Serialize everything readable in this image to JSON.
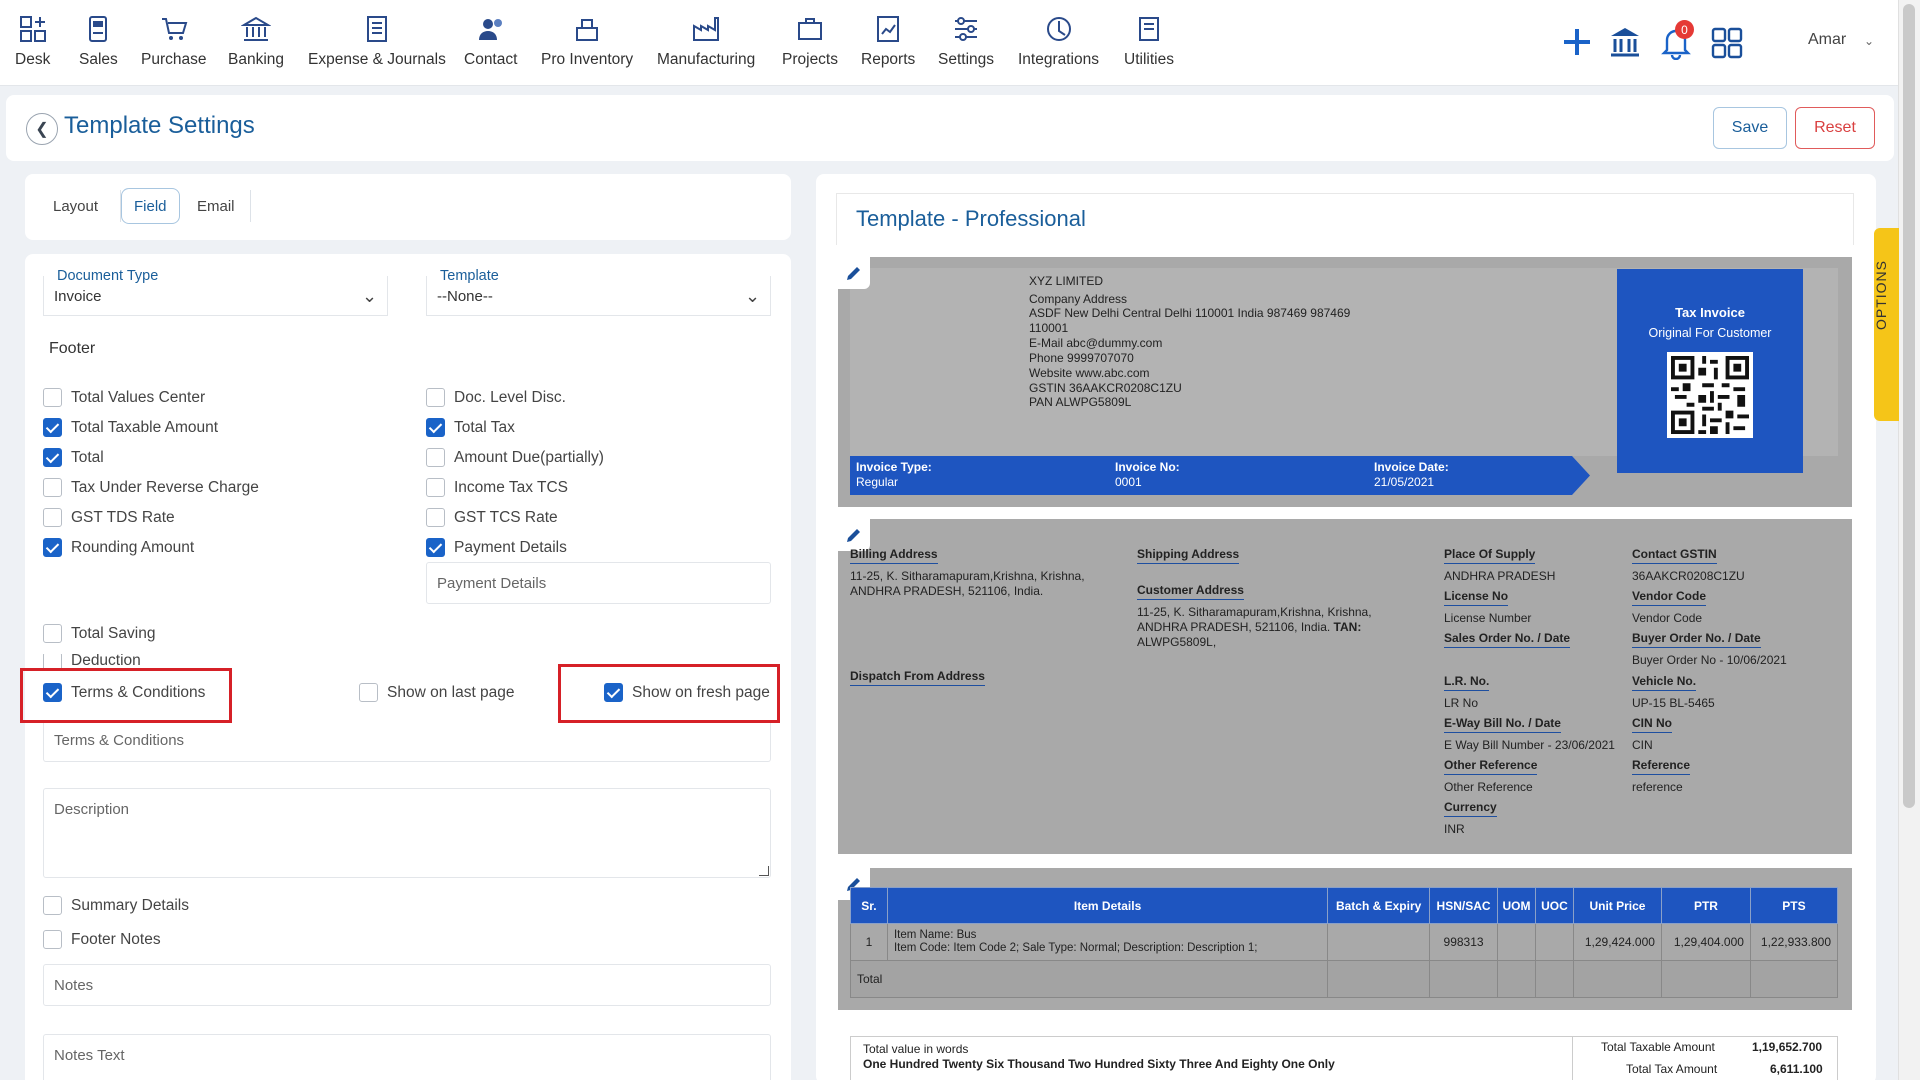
{
  "nav": {
    "items": [
      {
        "label": "Desk",
        "icon": "desk-icon"
      },
      {
        "label": "Sales",
        "icon": "sales-icon"
      },
      {
        "label": "Purchase",
        "icon": "purchase-cart-icon"
      },
      {
        "label": "Banking",
        "icon": "bank-icon"
      },
      {
        "label": "Expense & Journals",
        "icon": "journal-icon"
      },
      {
        "label": "Contact",
        "icon": "contact-icon"
      },
      {
        "label": "Pro Inventory",
        "icon": "inventory-icon"
      },
      {
        "label": "Manufacturing",
        "icon": "factory-icon"
      },
      {
        "label": "Projects",
        "icon": "projects-icon"
      },
      {
        "label": "Reports",
        "icon": "reports-icon"
      },
      {
        "label": "Settings",
        "icon": "sliders-icon"
      },
      {
        "label": "Integrations",
        "icon": "integrations-icon"
      },
      {
        "label": "Utilities",
        "icon": "utilities-icon"
      }
    ],
    "notification_count": "0",
    "user": "Amar",
    "accent": "#1a63c8"
  },
  "page": {
    "title": "Template Settings",
    "save": "Save",
    "reset": "Reset"
  },
  "tabs": {
    "layout": "Layout",
    "field": "Field",
    "email": "Email"
  },
  "form": {
    "doc_type_label": "Document Type",
    "doc_type_value": "Invoice",
    "template_label": "Template",
    "template_value": "--None--",
    "footer_heading": "Footer",
    "left_checks": [
      {
        "label": "Total Values Center",
        "checked": false
      },
      {
        "label": "Total Taxable Amount",
        "checked": true
      },
      {
        "label": "Total",
        "checked": true
      },
      {
        "label": "Tax Under Reverse Charge",
        "checked": false
      },
      {
        "label": "GST TDS Rate",
        "checked": false
      },
      {
        "label": "Rounding Amount",
        "checked": true
      }
    ],
    "right_checks": [
      {
        "label": "Doc. Level Disc.",
        "checked": false
      },
      {
        "label": "Total Tax",
        "checked": true
      },
      {
        "label": "Amount Due(partially)",
        "checked": false
      },
      {
        "label": "Income Tax TCS",
        "checked": false
      },
      {
        "label": "GST TCS Rate",
        "checked": false
      },
      {
        "label": "Payment Details",
        "checked": true
      }
    ],
    "payment_details_field": "Payment Details",
    "total_saving": "Total Saving",
    "deduction": "Deduction",
    "terms": "Terms & Conditions",
    "show_last_page": "Show on last page",
    "show_fresh_page": "Show on fresh page",
    "terms_field": "Terms & Conditions",
    "description_placeholder": "Description",
    "summary_details": "Summary Details",
    "footer_notes": "Footer Notes",
    "notes_field": "Notes",
    "notes_text_placeholder": "Notes Text"
  },
  "preview": {
    "title": "Template - Professional",
    "options": "OPTIONS",
    "company": {
      "name": "XYZ LIMITED",
      "address_label": "Company Address",
      "address_1": "ASDF New Delhi Central Delhi 110001 India 987469 987469",
      "address_2": "110001",
      "email_label": "E-Mail",
      "email": "abc@dummy.com",
      "phone_label": "Phone",
      "phone": "9999707070",
      "website_label": "Website",
      "website": "www.abc.com",
      "gstin_label": "GSTIN",
      "gstin": "36AAKCR0208C1ZU",
      "pan_label": "PAN",
      "pan": "ALWPG5809L"
    },
    "tax_box": {
      "title": "Tax Invoice",
      "subtitle": "Original For Customer"
    },
    "banner": {
      "type_label": "Invoice Type:",
      "type_value": "Regular",
      "no_label": "Invoice No:",
      "no_value": "0001",
      "date_label": "Invoice Date:",
      "date_value": "21/05/2021"
    },
    "billing_label": "Billing Address",
    "billing_1": "11-25, K. Sitharamapuram,Krishna, Krishna,",
    "billing_2": "ANDHRA PRADESH, 521106, India.",
    "shipping_label": "Shipping Address",
    "customer_label": "Customer Address",
    "customer_1": "11-25, K. Sitharamapuram,Krishna, Krishna,",
    "customer_2": "ANDHRA PRADESH, 521106, India.",
    "customer_tan_label": "TAN:",
    "customer_3": "ALWPG5809L,",
    "dispatch_label": "Dispatch From Address",
    "col3": [
      {
        "label": "Place Of Supply",
        "value": "ANDHRA PRADESH"
      },
      {
        "label": "License No",
        "value": "License Number"
      },
      {
        "label": "Sales Order No. / Date",
        "value": ""
      },
      {
        "label": "L.R. No.",
        "value": "LR No"
      },
      {
        "label": "E-Way Bill No. / Date",
        "value": "E Way Bill Number - 23/06/2021"
      },
      {
        "label": "Other Reference",
        "value": "Other Reference"
      },
      {
        "label": "Currency",
        "value": "INR"
      }
    ],
    "col4": [
      {
        "label": "Contact GSTIN",
        "value": "36AAKCR0208C1ZU"
      },
      {
        "label": "Vendor Code",
        "value": "Vendor Code"
      },
      {
        "label": "Buyer Order No. / Date",
        "value": "Buyer Order No - 10/06/2021"
      },
      {
        "label": "Vehicle No.",
        "value": "UP-15 BL-5465"
      },
      {
        "label": "CIN No",
        "value": "CIN"
      },
      {
        "label": "Reference",
        "value": "reference"
      }
    ],
    "table": {
      "headers": [
        "Sr.",
        "Item Details",
        "Batch & Expiry",
        "HSN/SAC",
        "UOM",
        "UOC",
        "Unit Price",
        "PTR",
        "PTS"
      ],
      "row": {
        "sr": "1",
        "item_1": "Item Name: Bus",
        "item_2": "Item Code: Item Code 2; Sale Type: Normal; Description: Description 1;",
        "batch": "",
        "hsn": "998313",
        "uom": "",
        "uoc": "",
        "unit_price": "1,29,424.000",
        "ptr": "1,29,404.000",
        "pts": "1,22,933.800"
      },
      "total_label": "Total"
    },
    "summary": {
      "words_label": "Total value in words",
      "words": "One Hundred Twenty Six Thousand Two Hundred Sixty Three And Eighty One Only",
      "taxable_label": "Total Taxable Amount",
      "taxable": "1,19,652.700",
      "tax_label": "Total Tax Amount",
      "tax": "6,611.100"
    }
  }
}
